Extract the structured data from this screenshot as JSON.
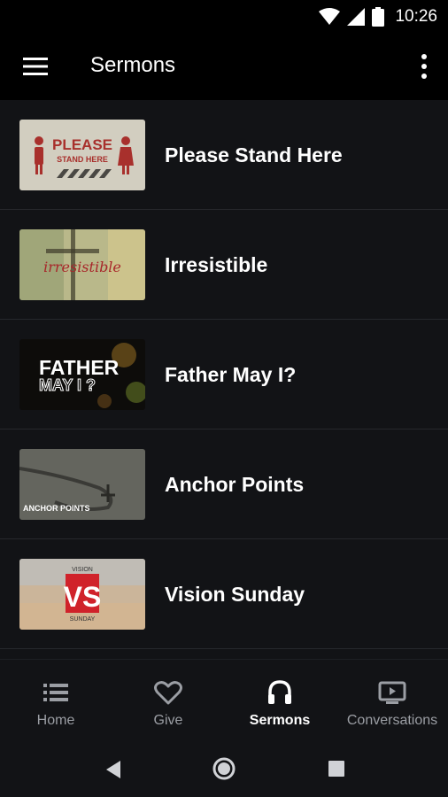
{
  "status": {
    "time": "10:26",
    "icons": [
      "wifi-icon",
      "signal-icon",
      "battery-icon"
    ]
  },
  "app_bar": {
    "title": "Sermons",
    "menu_icon": "menu-icon",
    "more_icon": "more-vertical-icon"
  },
  "sermons": [
    {
      "title": "Please Stand Here",
      "thumb_text": [
        "PLEASE",
        "STAND HERE"
      ]
    },
    {
      "title": "Irresistible",
      "thumb_text": [
        "irresistible"
      ]
    },
    {
      "title": "Father May I?",
      "thumb_text": [
        "FATHER",
        "MAY I ?"
      ]
    },
    {
      "title": "Anchor Points",
      "thumb_text": [
        "ANCHOR POINTS"
      ]
    },
    {
      "title": "Vision Sunday",
      "thumb_text": [
        "VISION",
        "VS",
        "SUNDAY"
      ]
    }
  ],
  "bottom_nav": [
    {
      "label": "Home",
      "icon": "list-icon",
      "active": false
    },
    {
      "label": "Give",
      "icon": "heart-icon",
      "active": false
    },
    {
      "label": "Sermons",
      "icon": "headphones-icon",
      "active": true
    },
    {
      "label": "Conversations",
      "icon": "video-icon",
      "active": false
    }
  ],
  "system_nav": [
    "back-icon",
    "home-icon",
    "recents-icon"
  ],
  "colors": {
    "background": "#121316",
    "bar": "#000000",
    "inactive": "#9b9ea4",
    "vs_red": "#d0222a"
  }
}
